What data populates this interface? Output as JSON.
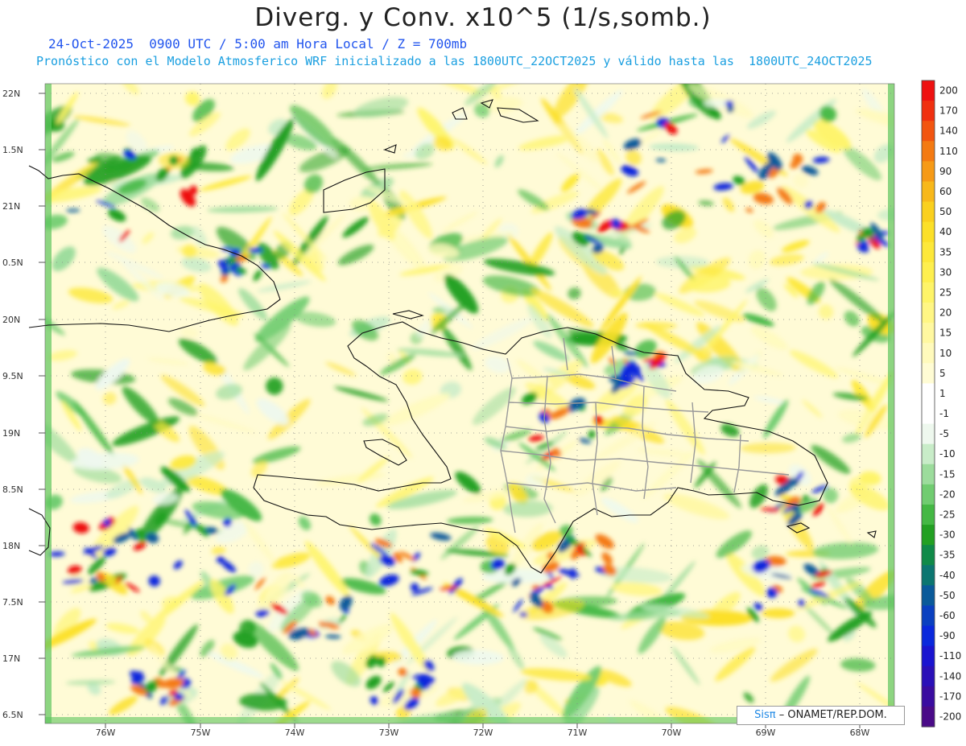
{
  "header": {
    "title": "Diverg. y Conv. x10^5 (1/s,somb.)",
    "line1": "24-Oct-2025  0900 UTC / 5:00 am Hora Local / Z = 700mb",
    "line2": "Pronóstico con el Modelo Atmosferico WRF inicializado a las 1800UTC_22OCT2025 y válido hasta las  1800UTC_24OCT2025"
  },
  "axes": {
    "lat_labels": [
      "22N",
      "1.5N",
      "21N",
      "0.5N",
      "20N",
      "9.5N",
      "19N",
      "8.5N",
      "18N",
      "7.5N",
      "17N",
      "6.5N"
    ],
    "lon_labels": [
      "76W",
      "75W",
      "74W",
      "73W",
      "72W",
      "71W",
      "70W",
      "69W",
      "68W"
    ]
  },
  "colorbar": {
    "labels": [
      "200",
      "170",
      "140",
      "110",
      "90",
      "60",
      "50",
      "40",
      "35",
      "30",
      "25",
      "20",
      "15",
      "10",
      "5",
      "1",
      "-1",
      "-5",
      "-10",
      "-15",
      "-20",
      "-25",
      "-30",
      "-35",
      "-40",
      "-50",
      "-60",
      "-90",
      "-110",
      "-140",
      "-170",
      "-200"
    ],
    "colors": [
      "#ee1111",
      "#f03010",
      "#f25510",
      "#f47a12",
      "#f69a16",
      "#f8b81a",
      "#fad01e",
      "#fce028",
      "#fde83a",
      "#feef4e",
      "#fef468",
      "#fff684",
      "#fff8a0",
      "#fffabc",
      "#fffcd4",
      "#ffffff",
      "#ffffff",
      "#eef8ee",
      "#c8ecc8",
      "#9cdc9c",
      "#70cc70",
      "#44b844",
      "#22a022",
      "#108a48",
      "#0c7670",
      "#0a5a9a",
      "#0a40c0",
      "#0a28dc",
      "#1a14d0",
      "#2a10b8",
      "#3a0ca0",
      "#4a0a88"
    ]
  },
  "credit": {
    "logo": "Sisπ",
    "text": "– ONAMET/REP.DOM."
  }
}
